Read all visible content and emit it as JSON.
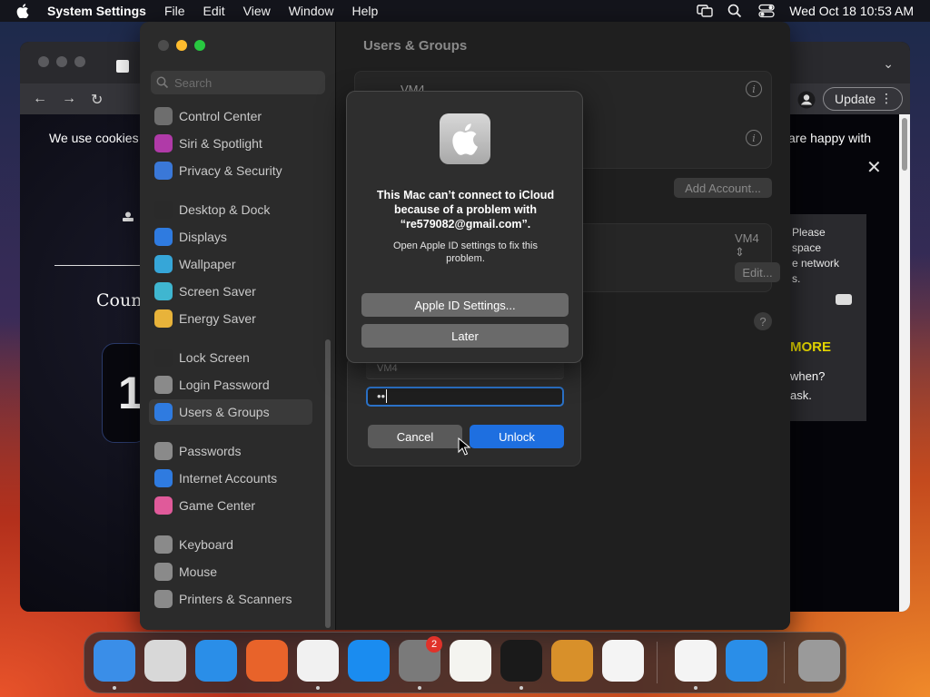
{
  "menubar": {
    "app_name": "System Settings",
    "menus": [
      "File",
      "Edit",
      "View",
      "Window",
      "Help"
    ],
    "clock": "Wed Oct 18  10:53 AM"
  },
  "browser": {
    "update_label": "Update",
    "cookie_left": "We use cookies",
    "cookie_right": "are happy with",
    "count_label": "Count",
    "count_digit": "1",
    "side_text": [
      "Please",
      "space",
      "e network",
      "s."
    ],
    "more_label": "MORE",
    "when_lines": [
      "when?",
      "ask."
    ]
  },
  "settings": {
    "search_placeholder": "Search",
    "sidebar_items": [
      {
        "label": "Control Center",
        "color": "#6e6e6e"
      },
      {
        "label": "Siri & Spotlight",
        "color": "#b03aa8"
      },
      {
        "label": "Privacy & Security",
        "color": "#3a78d8"
      },
      {
        "label": "Desktop & Dock",
        "color": "#2a2a2a"
      },
      {
        "label": "Displays",
        "color": "#2f7be0"
      },
      {
        "label": "Wallpaper",
        "color": "#36a6d8"
      },
      {
        "label": "Screen Saver",
        "color": "#3fb6d0"
      },
      {
        "label": "Energy Saver",
        "color": "#e8b33a"
      },
      {
        "label": "Lock Screen",
        "color": "#2a2a2a"
      },
      {
        "label": "Login Password",
        "color": "#8a8a8a"
      },
      {
        "label": "Users & Groups",
        "color": "#2f7be0"
      },
      {
        "label": "Passwords",
        "color": "#8a8a8a"
      },
      {
        "label": "Internet Accounts",
        "color": "#2f7be0"
      },
      {
        "label": "Game Center",
        "color": "#e05a9a"
      },
      {
        "label": "Keyboard",
        "color": "#8a8a8a"
      },
      {
        "label": "Mouse",
        "color": "#8a8a8a"
      },
      {
        "label": "Printers & Scanners",
        "color": "#8a8a8a"
      }
    ],
    "selected_item": "Users & Groups",
    "content_title": "Users & Groups",
    "user_name": "VM4",
    "add_account_label": "Add Account...",
    "auto_login_value": "VM4",
    "edit_label": "Edit...",
    "help_label": "?"
  },
  "unlock_sheet": {
    "username": "VM4",
    "password_mask": "••",
    "cancel_label": "Cancel",
    "unlock_label": "Unlock"
  },
  "alert": {
    "title": "This Mac can’t connect to iCloud because of a problem with “re579082@gmail.com”.",
    "body": "Open Apple ID settings to fix this problem.",
    "primary_label": "Apple ID Settings...",
    "secondary_label": "Later"
  },
  "dock": {
    "apps": [
      {
        "name": "finder-icon",
        "color": "#3a8ee8"
      },
      {
        "name": "launchpad-icon",
        "color": "#d8d8d8"
      },
      {
        "name": "safari-icon",
        "color": "#2a8ee8"
      },
      {
        "name": "firefox-icon",
        "color": "#e8632a"
      },
      {
        "name": "chrome-icon",
        "color": "#f1f1f1"
      },
      {
        "name": "app-store-icon",
        "color": "#1a8cf0"
      },
      {
        "name": "system-settings-icon",
        "color": "#7a7a7a"
      },
      {
        "name": "textedit-icon",
        "color": "#f4f4f0"
      },
      {
        "name": "terminal-icon",
        "color": "#1a1a1a"
      },
      {
        "name": "garageband-icon",
        "color": "#d8902a"
      },
      {
        "name": "vscode-icon",
        "color": "#f4f4f4"
      },
      {
        "name": "visual-studio-icon",
        "color": "#f4f4f4"
      },
      {
        "name": "weather-icon",
        "color": "#2a8ee8"
      },
      {
        "name": "trash-icon",
        "color": "#9a9a9a"
      }
    ],
    "settings_badge": "2"
  }
}
